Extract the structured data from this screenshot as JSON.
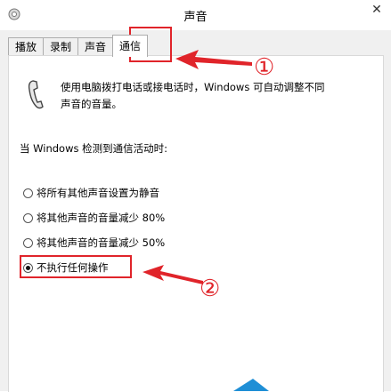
{
  "window": {
    "title": "声音",
    "close_glyph": "✕"
  },
  "tabs": [
    {
      "label": "播放"
    },
    {
      "label": "录制"
    },
    {
      "label": "声音"
    },
    {
      "label": "通信",
      "active": true
    }
  ],
  "comm": {
    "description_line1": "使用电脑拨打电话或接电话时，Windows 可自动调整不同",
    "description_line2": "声音的音量。",
    "detect_label": "当 Windows 检测到通信活动时:",
    "options": [
      {
        "label": "将所有其他声音设置为静音",
        "selected": false
      },
      {
        "label": "将其他声音的音量减少 80%",
        "selected": false
      },
      {
        "label": "将其他声音的音量减少 50%",
        "selected": false
      },
      {
        "label": "不执行任何操作",
        "selected": true
      }
    ]
  },
  "annotations": {
    "marker1": "①",
    "marker2": "②",
    "color": "#e0242a"
  },
  "icons": {
    "app": "speaker-settings-icon",
    "phone": "phone-handset-icon"
  }
}
